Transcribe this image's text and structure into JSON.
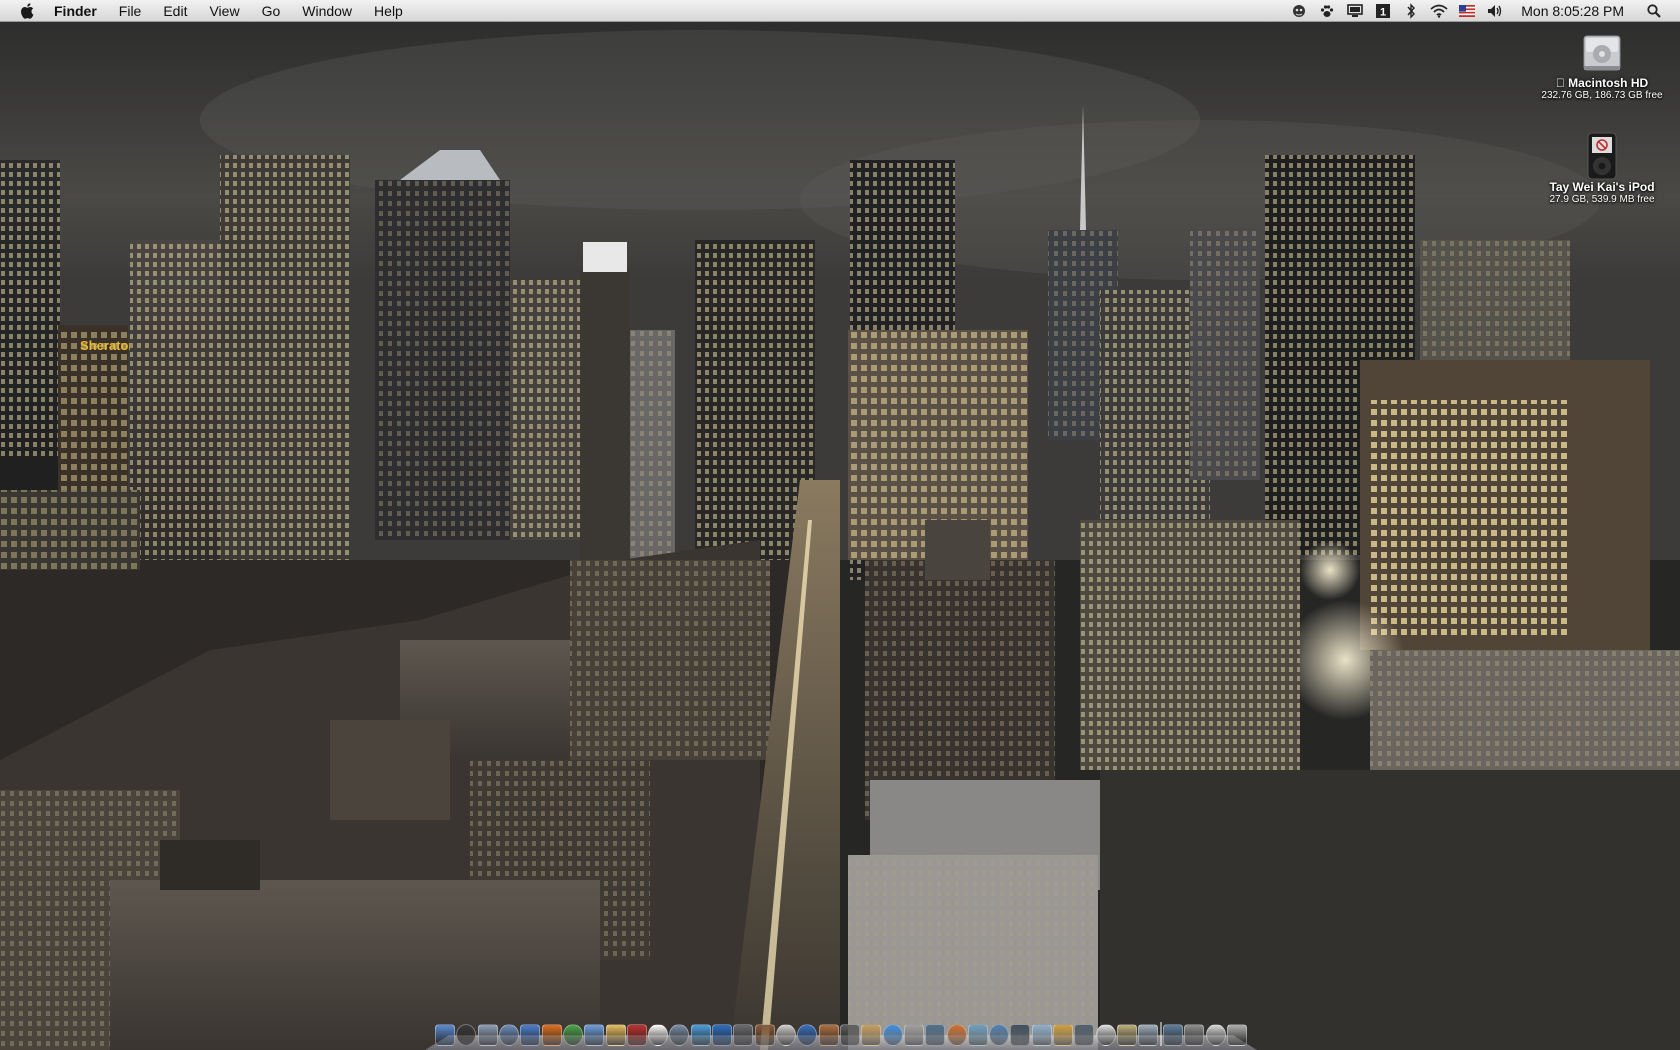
{
  "menubar": {
    "app_name": "Finder",
    "menus": [
      "File",
      "Edit",
      "View",
      "Go",
      "Window",
      "Help"
    ],
    "clock": "Mon 8:05:28 PM"
  },
  "desktop_icons": [
    {
      "label": "Macintosh HD",
      "info": "232.76 GB, 186.73 GB free"
    },
    {
      "label": "Tay Wei Kai's iPod",
      "info": "27.9 GB, 539.9 MB free"
    }
  ],
  "wallpaper": {
    "sign_text": "Sheraton"
  },
  "dock": {
    "colors": [
      "#5b8cd6",
      "#3a3a3a",
      "#8fa0b8",
      "#6f8fbf",
      "#4a7fd0",
      "#e07020",
      "#4ca64c",
      "#6fa0e0",
      "#e8c060",
      "#c03030",
      "#ffffff",
      "#7a8fa8",
      "#4aa0e0",
      "#2e6fc4",
      "#6a6a70",
      "#8a5a3a",
      "#d0d0d0",
      "#3a70c0",
      "#b07040",
      "#606060",
      "#c8a060",
      "#4090e0",
      "#a0a0a0",
      "#507090",
      "#d07030",
      "#70a0c0",
      "#5080b0",
      "#405060",
      "#90b0d0",
      "#d0a040",
      "#506070",
      "#e0e0e0",
      "#c0b080",
      "#a0b0c0",
      "#6080a0",
      "#909090",
      "#d8d8d8",
      "#b0b0b0"
    ]
  }
}
